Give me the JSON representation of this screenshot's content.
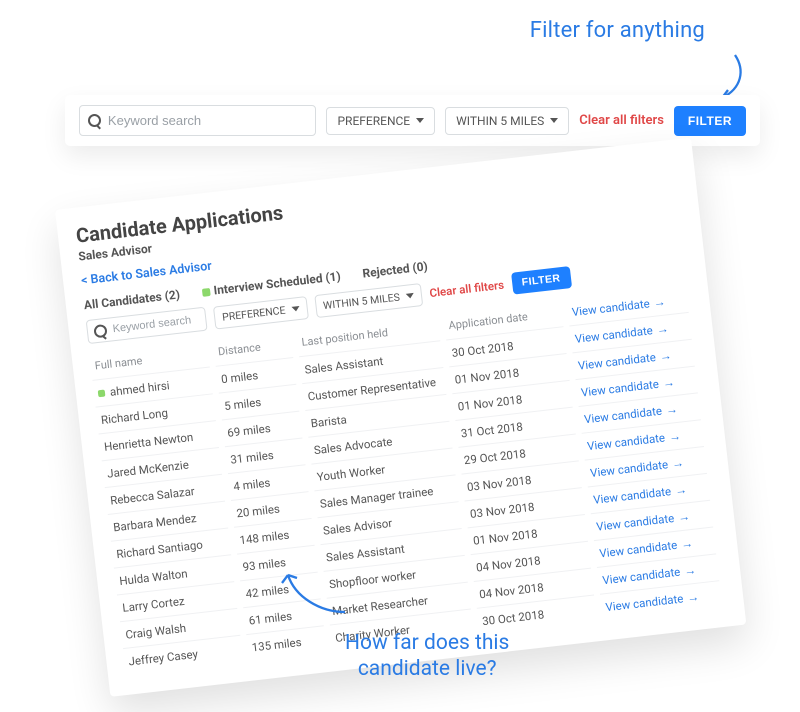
{
  "annotations": {
    "top": "Filter for anything",
    "bottom_line1": "How far does this",
    "bottom_line2": "candidate live?"
  },
  "filter_bar": {
    "search_placeholder": "Keyword search",
    "preference_label": "PREFERENCE",
    "within_label": "WITHIN 5 MILES",
    "clear_label": "Clear all filters",
    "filter_btn": "FILTER"
  },
  "card": {
    "title": "Candidate Applications",
    "subtitle": "Sales Advisor",
    "back_link": "< Back to Sales Advisor",
    "tabs": {
      "all": "All Candidates (2)",
      "interview": "Interview Scheduled (1)",
      "rejected": "Rejected (0)"
    },
    "headers": {
      "name": "Full name",
      "distance": "Distance",
      "position": "Last position held",
      "date": "Application date",
      "view": "View candidate"
    },
    "view_label": "View candidate",
    "rows": [
      {
        "name": "ahmed hirsi",
        "distance": "0 miles",
        "position": "Sales Assistant",
        "date": "30 Oct 2018",
        "dot": true,
        "bold": true
      },
      {
        "name": "Richard Long",
        "distance": "5 miles",
        "position": "Customer Representative",
        "date": "01 Nov 2018",
        "bold": true
      },
      {
        "name": "Henrietta Newton",
        "distance": "69   miles",
        "position": "Barista",
        "date": "01 Nov 2018"
      },
      {
        "name": "Jared McKenzie",
        "distance": "31   miles",
        "position": "Sales Advocate",
        "date": "31 Oct 2018"
      },
      {
        "name": "Rebecca Salazar",
        "distance": "4   miles",
        "position": "Youth Worker",
        "date": "29 Oct 2018"
      },
      {
        "name": "Barbara Mendez",
        "distance": "20   miles",
        "position": "Sales Manager trainee",
        "date": "03 Nov 2018"
      },
      {
        "name": "Richard Santiago",
        "distance": "148   miles",
        "position": "Sales Advisor",
        "date": "03 Nov 2018"
      },
      {
        "name": "Hulda Walton",
        "distance": "93   miles",
        "position": "Sales Assistant",
        "date": "01 Nov 2018"
      },
      {
        "name": "Larry Cortez",
        "distance": "42   miles",
        "position": "Shopfloor worker",
        "date": "04 Nov 2018"
      },
      {
        "name": "Craig Walsh",
        "distance": "61   miles",
        "position": "Market Researcher",
        "date": "04 Nov 2018"
      },
      {
        "name": "Jeffrey Casey",
        "distance": "135   miles",
        "position": "Charity Worker",
        "date": "30 Oct 2018"
      }
    ]
  }
}
